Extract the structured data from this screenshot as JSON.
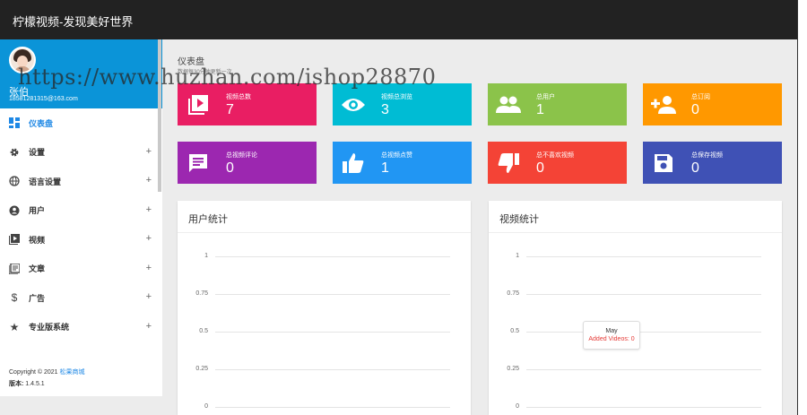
{
  "app": {
    "title": "柠檬视频-发现美好世界"
  },
  "user": {
    "name": "张伯",
    "email": "18581281315@163.com"
  },
  "menu": [
    {
      "label": "仪表盘",
      "icon": "dashboard-icon",
      "active": true
    },
    {
      "label": "设置",
      "icon": "gear-icon"
    },
    {
      "label": "语言设置",
      "icon": "globe-icon"
    },
    {
      "label": "用户",
      "icon": "account-icon"
    },
    {
      "label": "视频",
      "icon": "video-icon"
    },
    {
      "label": "文章",
      "icon": "article-icon"
    },
    {
      "label": "广告",
      "icon": "dollar-icon"
    },
    {
      "label": "专业版系统",
      "icon": "star-icon"
    }
  ],
  "menu_expand": "+",
  "footer": {
    "copyright": "Copyright © 2021",
    "company": "松果商城",
    "version_label": "版本:",
    "version": "1.4.5.1"
  },
  "page": {
    "title": "仪表盘",
    "subtitle": "数据每30分钟更新一次"
  },
  "cards": [
    {
      "label": "视频总数",
      "value": "7",
      "icon": "video-play-icon",
      "color": "#e91e63"
    },
    {
      "label": "视频总浏览",
      "value": "3",
      "icon": "eye-icon",
      "color": "#00bcd4"
    },
    {
      "label": "总用户",
      "value": "1",
      "icon": "people-icon",
      "color": "#8bc34a"
    },
    {
      "label": "总订阅",
      "value": "0",
      "icon": "person-add-icon",
      "color": "#ff9800"
    },
    {
      "label": "总视频评论",
      "value": "0",
      "icon": "comment-icon",
      "color": "#9c27b0"
    },
    {
      "label": "总视频点赞",
      "value": "1",
      "icon": "thumb-up-icon",
      "color": "#2196f3"
    },
    {
      "label": "总不喜欢视频",
      "value": "0",
      "icon": "thumb-down-icon",
      "color": "#f44336"
    },
    {
      "label": "总保存视频",
      "value": "0",
      "icon": "save-icon",
      "color": "#3f51b5"
    }
  ],
  "panels": {
    "users": {
      "title": "用户统计",
      "y_ticks": [
        "1",
        "0.75",
        "0.5",
        "0.25",
        "0"
      ]
    },
    "videos": {
      "title": "视频统计",
      "y_ticks": [
        "1",
        "0.75",
        "0.5",
        "0.25",
        "0"
      ],
      "tooltip": {
        "title": "May",
        "line": "Added Videos: 0"
      }
    }
  },
  "watermark": "https://www.huzhan.com/ishop28870"
}
